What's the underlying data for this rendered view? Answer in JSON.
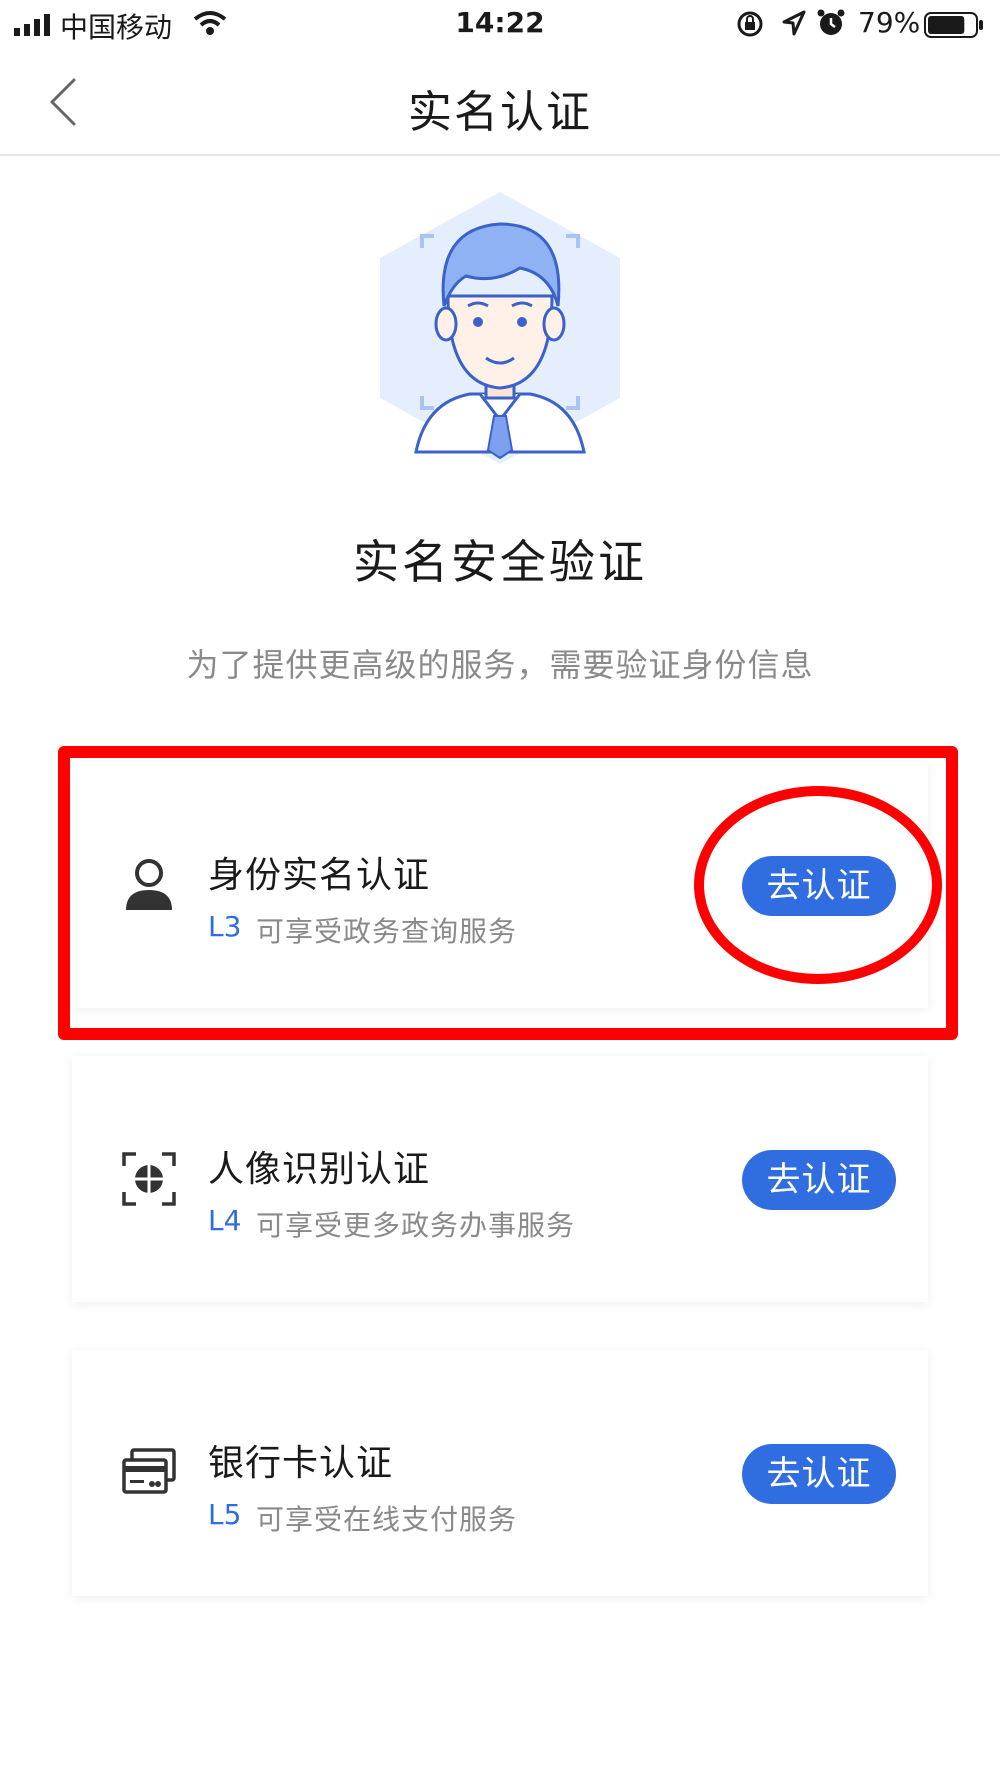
{
  "status_bar": {
    "carrier": "中国移动",
    "time": "14:22",
    "battery_percent": "79%",
    "battery_level": 0.79
  },
  "nav": {
    "title": "实名认证"
  },
  "hero": {
    "title": "实名安全验证",
    "subtitle": "为了提供更高级的服务，需要验证身份信息"
  },
  "cards": [
    {
      "icon": "person-icon",
      "title": "身份实名认证",
      "level": "L3",
      "desc": "可享受政务查询服务",
      "button": "去认证"
    },
    {
      "icon": "face-scan-icon",
      "title": "人像识别认证",
      "level": "L4",
      "desc": "可享受更多政务办事服务",
      "button": "去认证"
    },
    {
      "icon": "bank-card-icon",
      "title": "银行卡认证",
      "level": "L5",
      "desc": "可享受在线支付服务",
      "button": "去认证"
    }
  ],
  "colors": {
    "accent": "#2f6de0",
    "annotation": "#ff0000",
    "subtitle_gray": "#8a8a8a"
  }
}
